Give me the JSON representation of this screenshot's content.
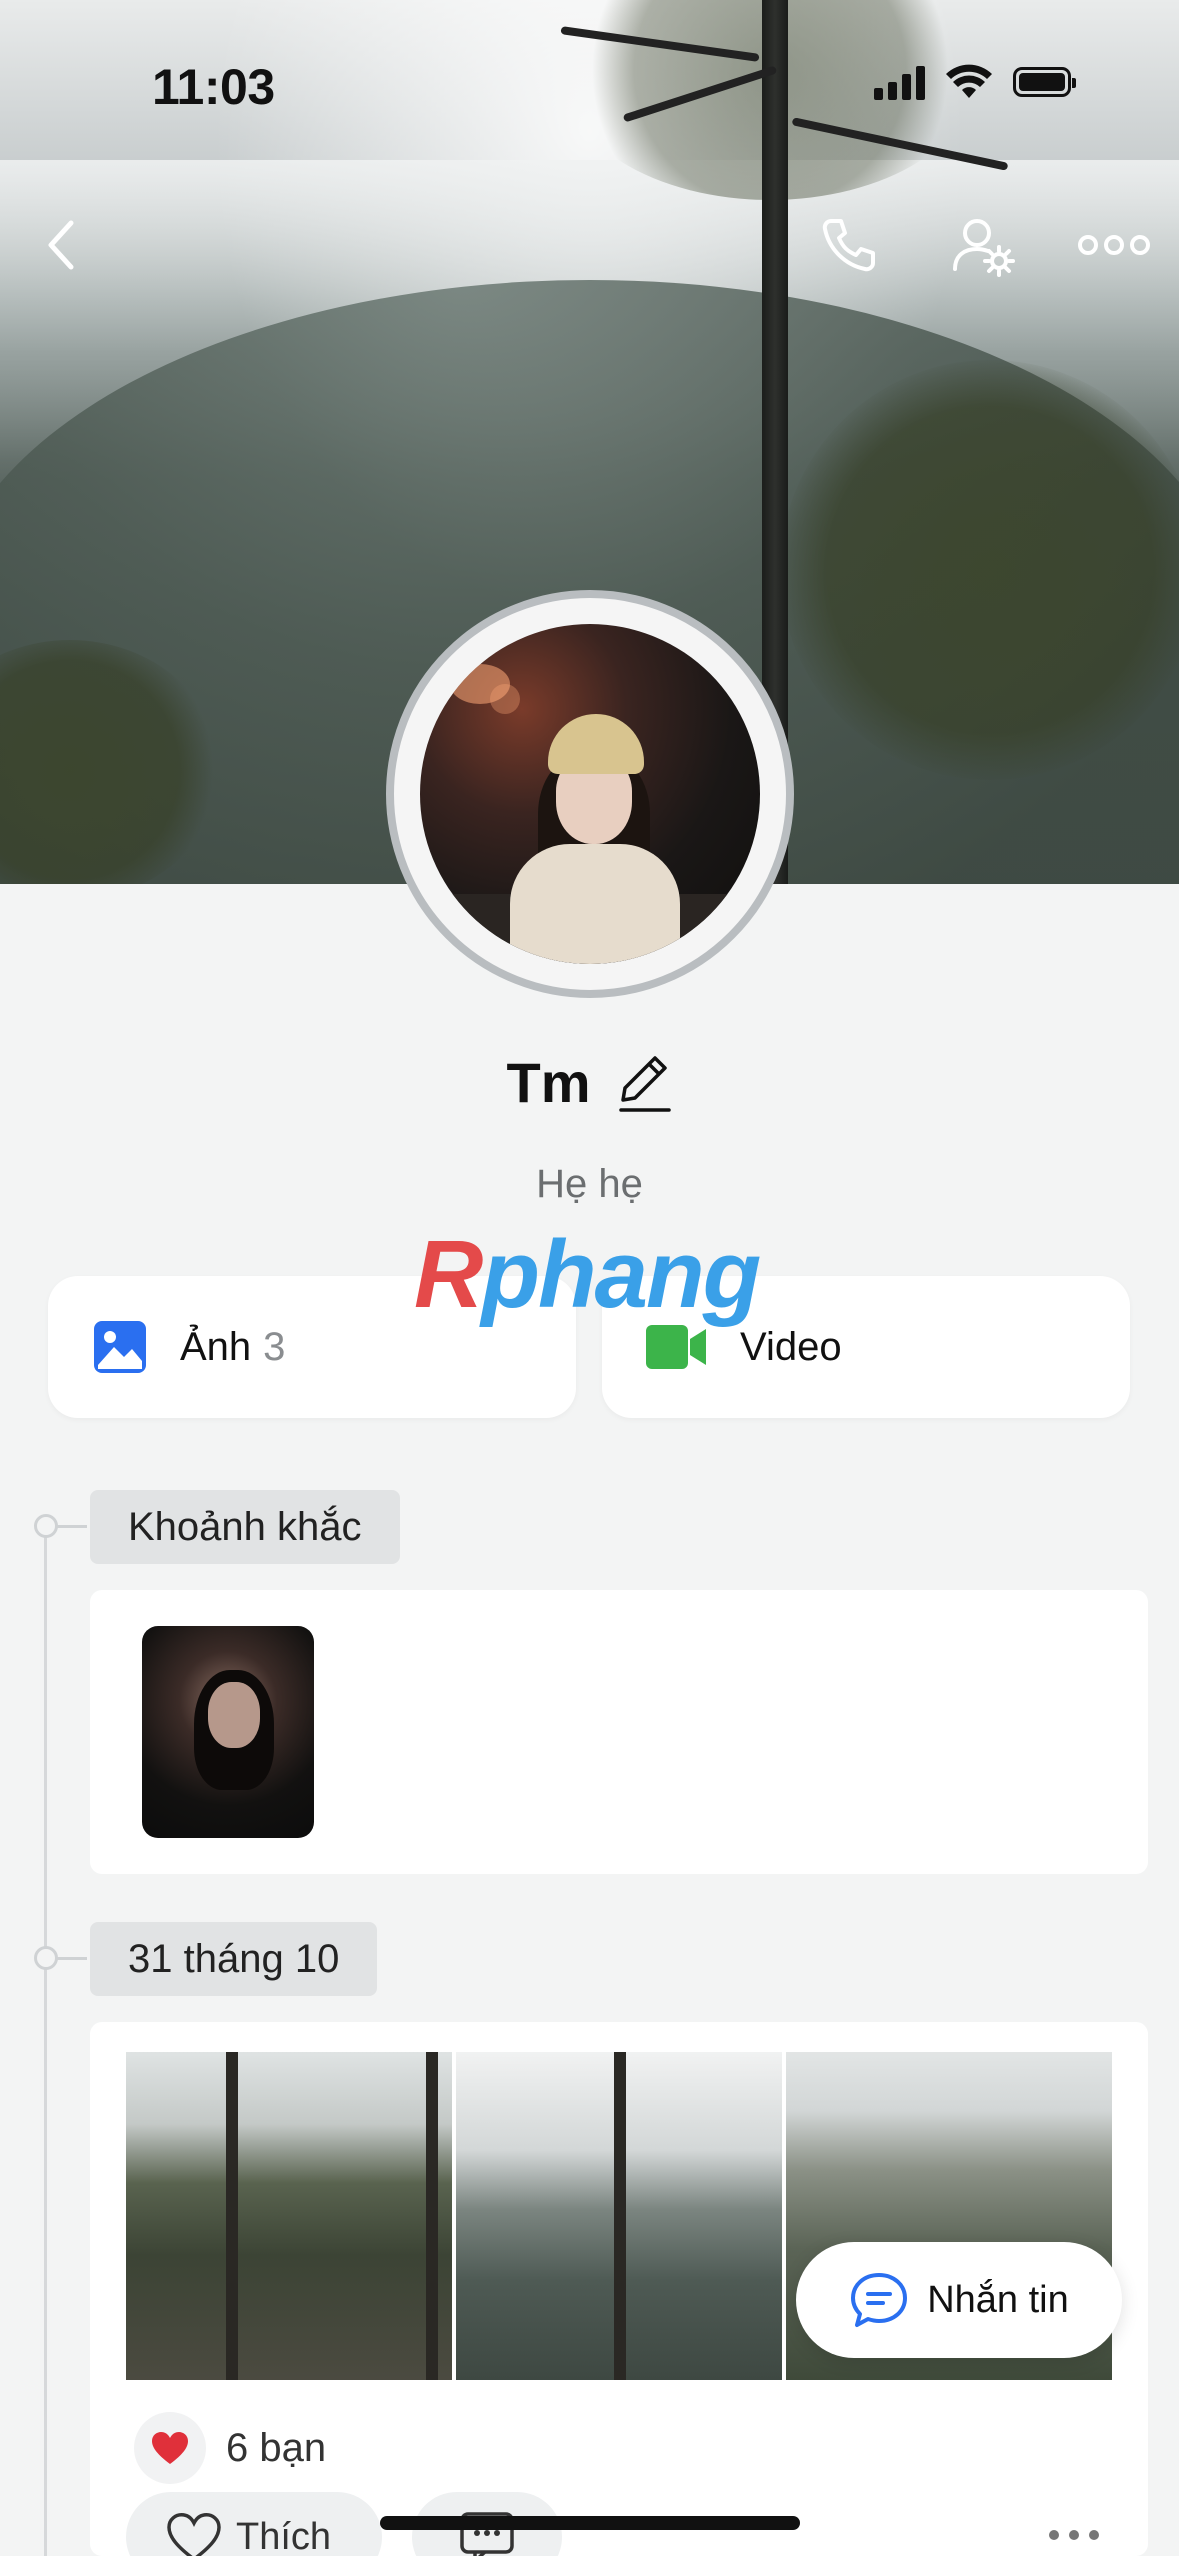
{
  "status_bar": {
    "time": "11:03"
  },
  "profile": {
    "name": "Tm",
    "bio": "Hẹ hẹ"
  },
  "watermark": {
    "first_letter": "R",
    "rest": "phang"
  },
  "media": {
    "photos_label": "Ảnh",
    "photos_count": "3",
    "video_label": "Video"
  },
  "timeline": {
    "moments_label": "Khoảnh khắc",
    "post_date": "31 tháng 10",
    "likes_text": "6 bạn",
    "like_button": "Thích"
  },
  "fab": {
    "message_label": "Nhắn tin"
  },
  "colors": {
    "accent_blue": "#2a6ff0",
    "video_green": "#3cb44a",
    "heart_red": "#e0303a",
    "background": "#f3f4f4"
  },
  "icons": [
    "back-icon",
    "phone-icon",
    "user-settings-icon",
    "more-icon",
    "edit-icon",
    "image-icon",
    "video-icon",
    "heart-icon",
    "comment-icon",
    "chat-icon"
  ]
}
